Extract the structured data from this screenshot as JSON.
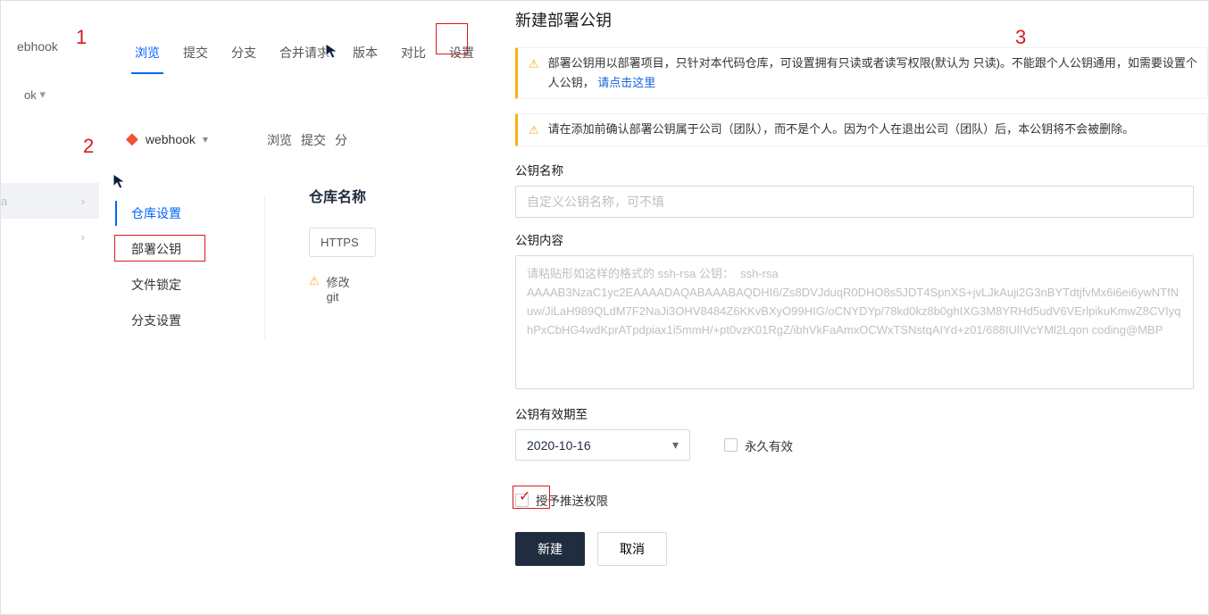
{
  "panel1": {
    "crumb": "ebhook",
    "tabs": [
      "浏览",
      "提交",
      "分支",
      "合并请求",
      "版本",
      "对比",
      "设置"
    ],
    "active_tab_index": 0,
    "crumb2": "ok"
  },
  "panel2": {
    "repo_name": "webhook",
    "tabs": [
      "浏览",
      "提交",
      "分"
    ],
    "tree_rows": [
      "a",
      ""
    ],
    "side_menu": [
      "仓库设置",
      "部署公钥",
      "文件锁定",
      "分支设置"
    ],
    "active_side_index": 0,
    "right_title": "仓库名称",
    "https_label": "HTTPS",
    "warn_line1": "修改",
    "warn_line2": "git"
  },
  "form": {
    "title": "新建部署公钥",
    "alert1": "部署公钥用以部署项目，只针对本代码仓库，可设置拥有只读或者读写权限(默认为 只读)。不能跟个人公钥通用，如需要设置个人公钥，",
    "alert1_link": "请点击这里",
    "alert2": "请在添加前确认部署公钥属于公司（团队），而不是个人。因为个人在退出公司（团队）后，本公钥将不会被删除。",
    "name_label": "公钥名称",
    "name_placeholder": "自定义公钥名称，可不填",
    "content_label": "公钥内容",
    "content_placeholder": "请粘贴形如这样的格式的 ssh-rsa 公钥：  ssh-rsa AAAAB3NzaC1yc2EAAAADAQABAAABAQDHI6/Zs8DVJduqR0DHO8s5JDT4SpnXS+jvLJkAuji2G3nBYTdtjfvMx6i6ei6ywNTfNuw/JiLaH989QLdM7F2NaJi3OHV8484Z6KKvBXyO99HIG/oCNYDYp/78kd0kz8b0ghIXG3M8YRHd5udV6VErlpikuKmwZ8CVIyqhPxCbHG4wdKprATpdpiax1i5mmH/+pt0vzK01RgZ/ibhVkFaAmxOCWxTSNstqAIYd+z01/688IUlIVcYMl2Lqon coding@MBP",
    "expiry_label": "公钥有效期至",
    "expiry_value": "2020-10-16",
    "forever_label": "永久有效",
    "push_label": "授予推送权限",
    "submit_label": "新建",
    "cancel_label": "取消"
  },
  "annotations": {
    "n1": "1",
    "n2": "2",
    "n3": "3"
  }
}
